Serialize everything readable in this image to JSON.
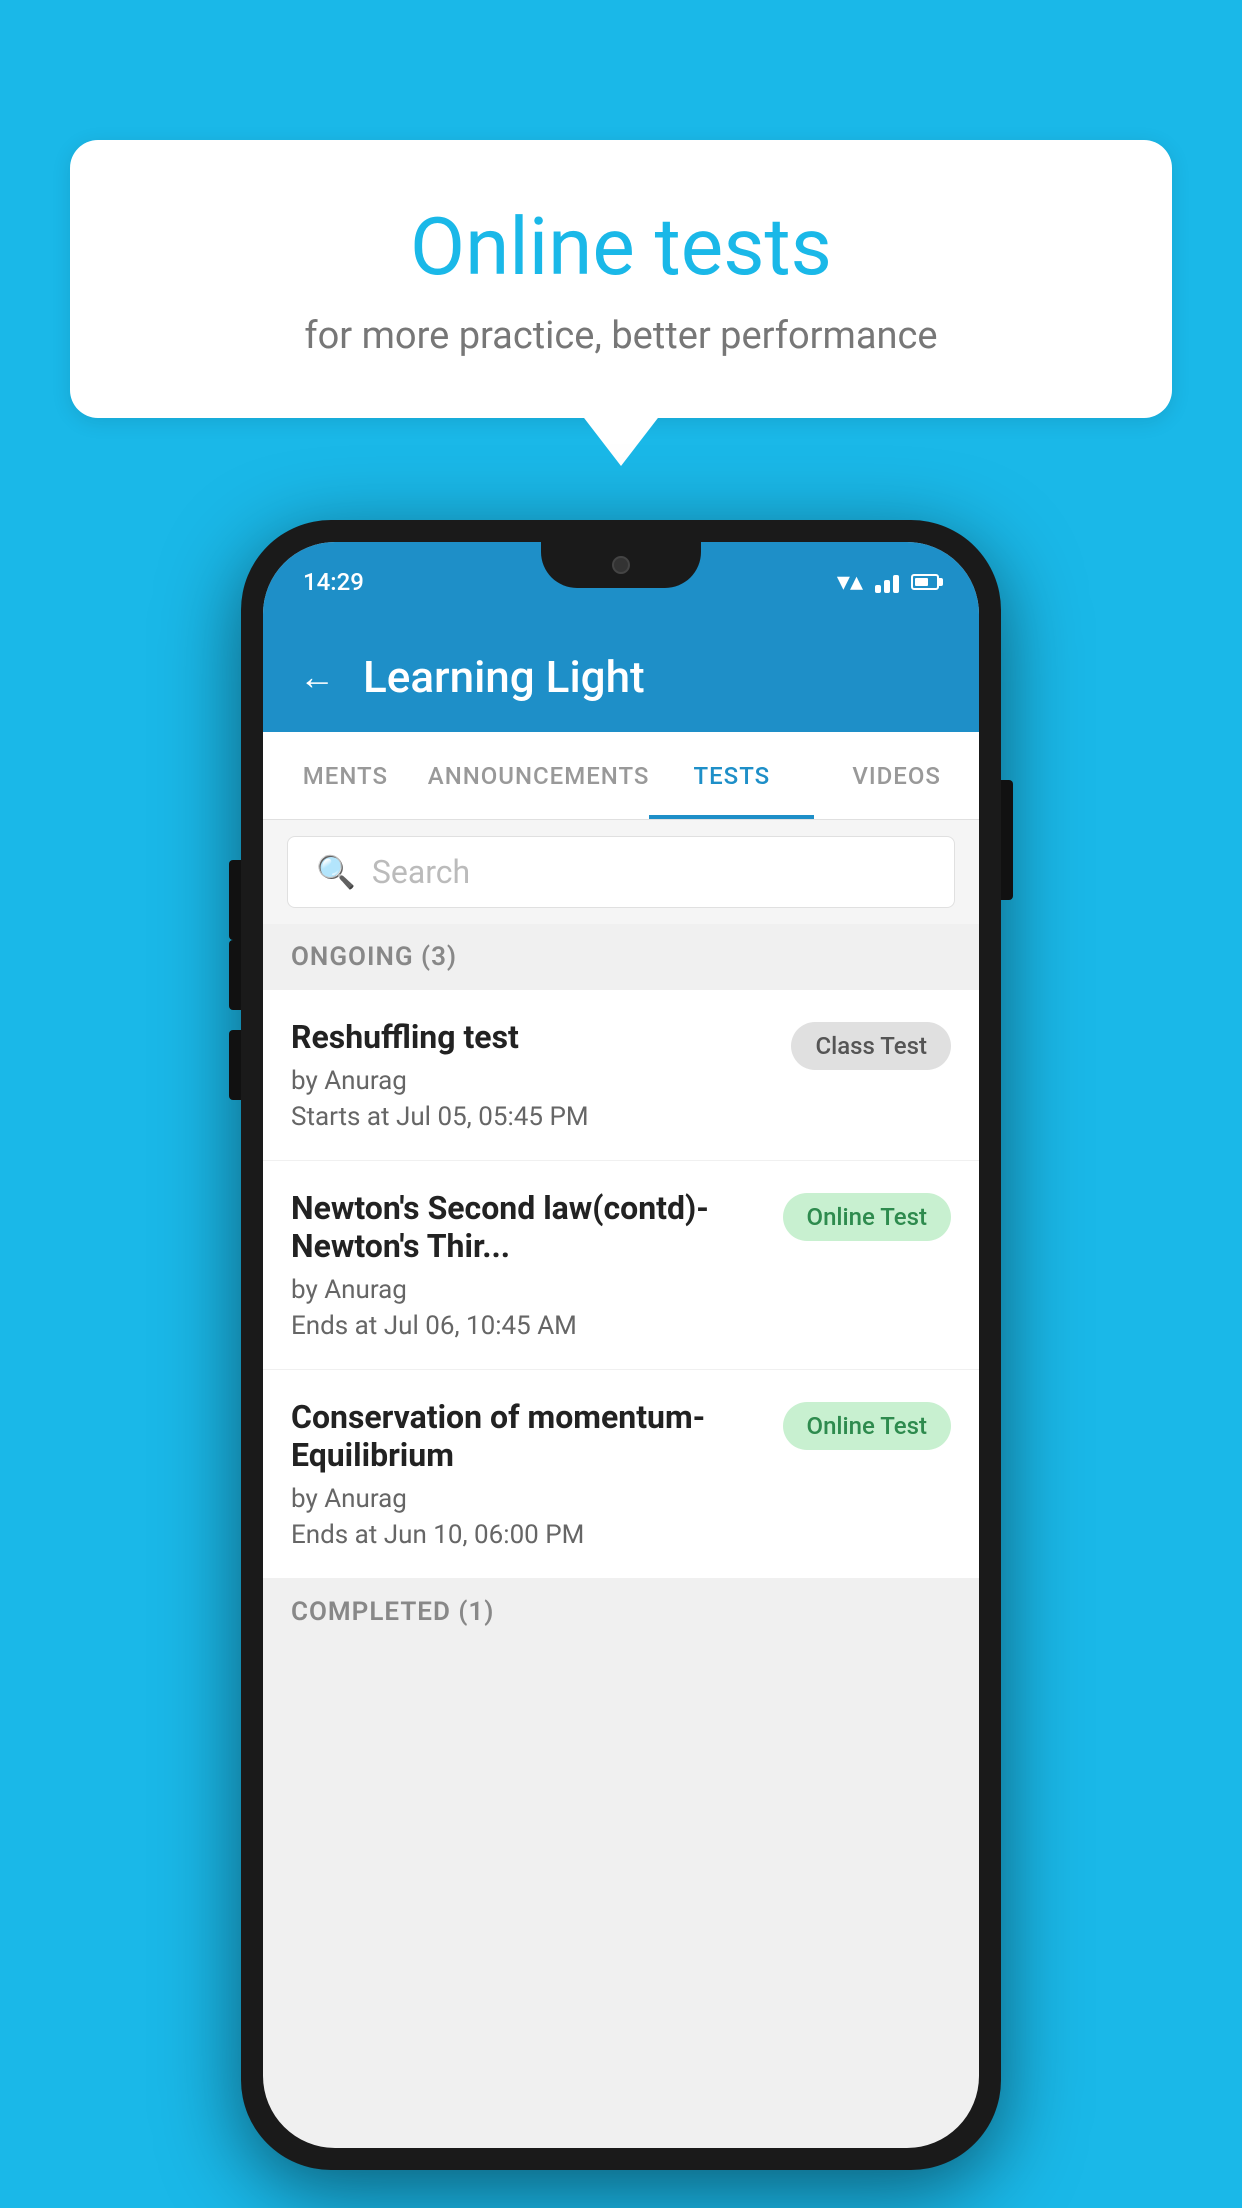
{
  "background_color": "#1ab8e8",
  "bubble": {
    "title": "Online tests",
    "subtitle": "for more practice, better performance"
  },
  "phone": {
    "status_bar": {
      "time": "14:29"
    },
    "app_bar": {
      "title": "Learning Light",
      "back_label": "←"
    },
    "tabs": [
      {
        "label": "MENTS",
        "active": false
      },
      {
        "label": "ANNOUNCEMENTS",
        "active": false
      },
      {
        "label": "TESTS",
        "active": true
      },
      {
        "label": "VIDEOS",
        "active": false
      }
    ],
    "search": {
      "placeholder": "Search"
    },
    "ongoing_section": {
      "label": "ONGOING (3)"
    },
    "tests": [
      {
        "title": "Reshuffling test",
        "author": "by Anurag",
        "date_label": "Starts at  Jul 05, 05:45 PM",
        "badge": "Class Test",
        "badge_type": "class"
      },
      {
        "title": "Newton's Second law(contd)-Newton's Thir...",
        "author": "by Anurag",
        "date_label": "Ends at  Jul 06, 10:45 AM",
        "badge": "Online Test",
        "badge_type": "online"
      },
      {
        "title": "Conservation of momentum-Equilibrium",
        "author": "by Anurag",
        "date_label": "Ends at  Jun 10, 06:00 PM",
        "badge": "Online Test",
        "badge_type": "online"
      }
    ],
    "completed_section": {
      "label": "COMPLETED (1)"
    }
  }
}
